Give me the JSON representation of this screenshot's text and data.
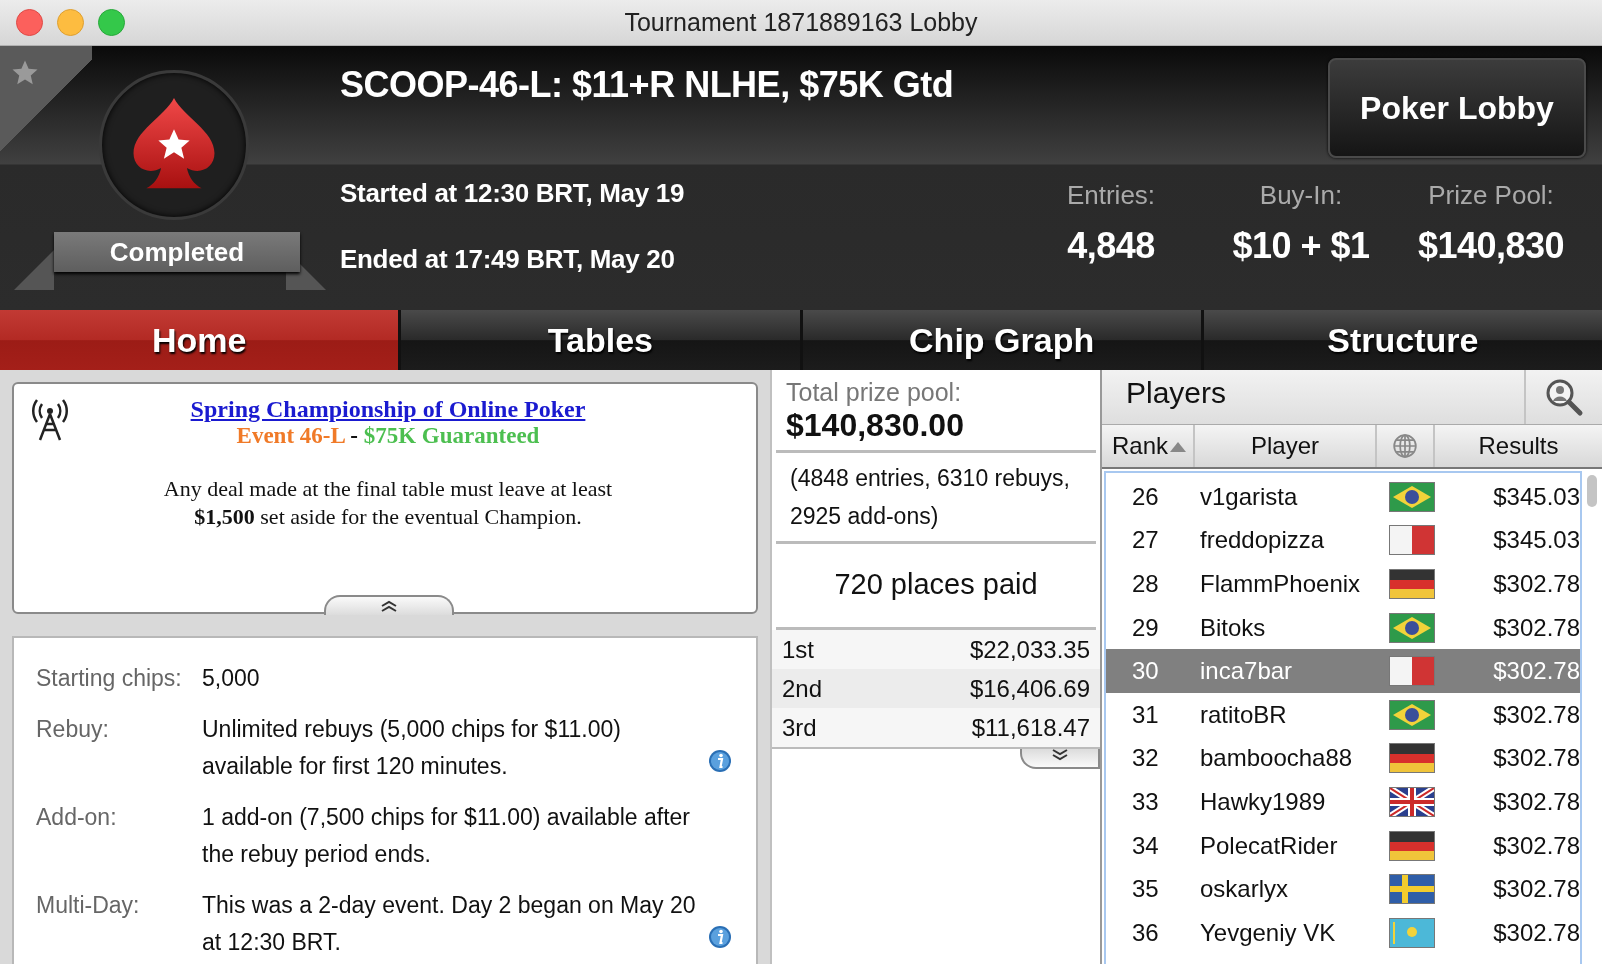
{
  "window": {
    "title": "Tournament 1871889163 Lobby"
  },
  "header": {
    "title": "SCOOP-46-L: $11+R NLHE, $75K Gtd",
    "status": "Completed",
    "started": "Started at 12:30 BRT, May 19",
    "ended": "Ended at 17:49 BRT, May 20",
    "lobby_button": "Poker Lobby",
    "stats": [
      {
        "label": "Entries:",
        "value": "4,848"
      },
      {
        "label": "Buy-In:",
        "value": "$10 + $1"
      },
      {
        "label": "Prize Pool:",
        "value": "$140,830"
      }
    ]
  },
  "tabs": [
    {
      "label": "Home",
      "selected": true
    },
    {
      "label": "Tables",
      "selected": false
    },
    {
      "label": "Chip Graph",
      "selected": false
    },
    {
      "label": "Structure",
      "selected": false
    }
  ],
  "info": {
    "link": "Spring Championship of Online Poker",
    "event": "Event 46-L",
    "separator": " - ",
    "guarantee": "$75K Guaranteed",
    "message": "Any deal made at the final table must leave at least **$1,500** set aside for the eventual Champion."
  },
  "details": [
    {
      "label": "Starting chips:",
      "value": "5,000",
      "info": false
    },
    {
      "label": "Rebuy:",
      "value": "Unlimited rebuys (5,000 chips for $11.00) available for first 120 minutes.",
      "info": true
    },
    {
      "label": "Add-on:",
      "value": "1 add-on (7,500 chips for $11.00) available after the rebuy period ends.",
      "info": false
    },
    {
      "label": "Multi-Day:",
      "value": "This was a 2-day event. Day 2 began on May 20 at 12:30 BRT.",
      "info": true
    }
  ],
  "prizes": {
    "label": "Total prize pool:",
    "total": "$140,830.00",
    "breakdown": "(4848 entries, 6310 rebuys, 2925 add-ons)",
    "places": "720 places paid",
    "payouts": [
      {
        "place": "1st",
        "amount": "$22,033.35"
      },
      {
        "place": "2nd",
        "amount": "$16,406.69"
      },
      {
        "place": "3rd",
        "amount": "$11,618.47"
      }
    ]
  },
  "players": {
    "title": "Players",
    "columns": [
      "Rank",
      "Player",
      "Results"
    ],
    "rows": [
      {
        "rank": "26",
        "name": "v1garista",
        "flag": {
          "kind": "br"
        },
        "result": "$345.03",
        "selected": false
      },
      {
        "rank": "27",
        "name": "freddopizza",
        "flag": {
          "kind": "mt"
        },
        "result": "$345.03",
        "selected": false
      },
      {
        "rank": "28",
        "name": "FlammPhoenix",
        "flag": {
          "kind": "de"
        },
        "result": "$302.78",
        "selected": false
      },
      {
        "rank": "29",
        "name": "Bitoks",
        "flag": {
          "kind": "br"
        },
        "result": "$302.78",
        "selected": false
      },
      {
        "rank": "30",
        "name": "inca7bar",
        "flag": {
          "kind": "mt"
        },
        "result": "$302.78",
        "selected": true
      },
      {
        "rank": "31",
        "name": "ratitoBR",
        "flag": {
          "kind": "br"
        },
        "result": "$302.78",
        "selected": false
      },
      {
        "rank": "32",
        "name": "bamboocha88",
        "flag": {
          "kind": "de"
        },
        "result": "$302.78",
        "selected": false
      },
      {
        "rank": "33",
        "name": "Hawky1989",
        "flag": {
          "kind": "gb"
        },
        "result": "$302.78",
        "selected": false
      },
      {
        "rank": "34",
        "name": "PolecatRider",
        "flag": {
          "kind": "de"
        },
        "result": "$302.78",
        "selected": false
      },
      {
        "rank": "35",
        "name": "oskarlyx",
        "flag": {
          "kind": "se"
        },
        "result": "$302.78",
        "selected": false
      },
      {
        "rank": "36",
        "name": "Yevgeniy VK",
        "flag": {
          "kind": "kz"
        },
        "result": "$302.78",
        "selected": false
      }
    ]
  }
}
